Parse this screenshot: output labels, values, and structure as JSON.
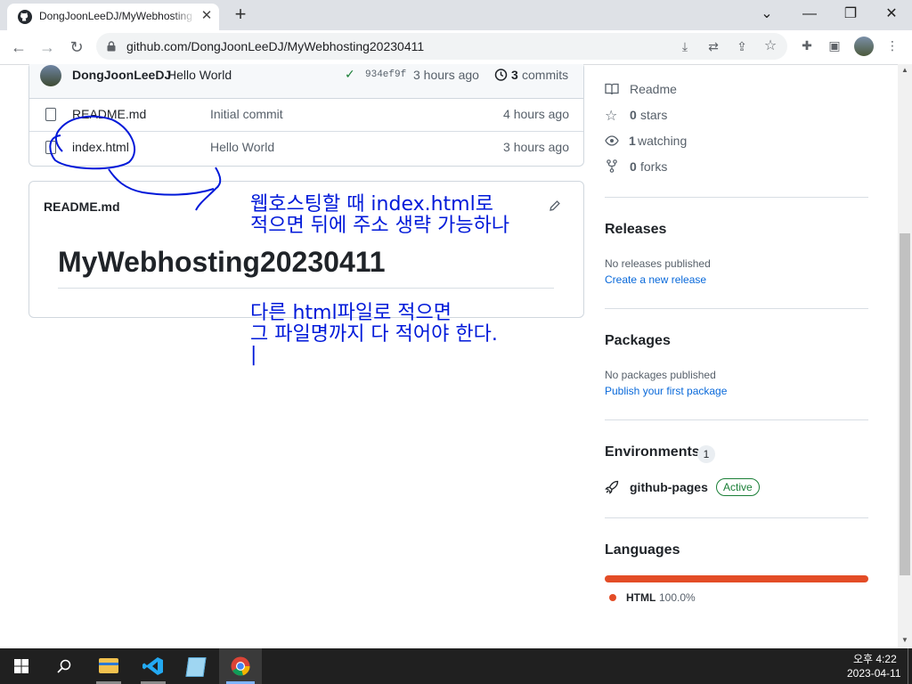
{
  "browser": {
    "tab_title": "DongJoonLeeDJ/MyWebhosting",
    "url": "github.com/DongJoonLeeDJ/MyWebhosting20230411"
  },
  "commit": {
    "author": "DongJoonLeeDJ",
    "message": "Hello World",
    "hash": "934ef9f",
    "time": "3 hours ago",
    "commits_count": "3",
    "commits_label": "commits"
  },
  "files": [
    {
      "name": "README.md",
      "message": "Initial commit",
      "time": "4 hours ago"
    },
    {
      "name": "index.html",
      "message": "Hello World",
      "time": "3 hours ago"
    }
  ],
  "readme": {
    "filename": "README.md",
    "heading": "MyWebhosting20230411"
  },
  "sidebar": {
    "readme_label": "Readme",
    "stars_count": "0",
    "stars_label": "stars",
    "watching_count": "1",
    "watching_label": "watching",
    "forks_count": "0",
    "forks_label": "forks",
    "releases_title": "Releases",
    "releases_none": "No releases published",
    "releases_link": "Create a new release",
    "packages_title": "Packages",
    "packages_none": "No packages published",
    "packages_link": "Publish your first package",
    "env_title": "Environments",
    "env_count": "1",
    "env_name": "github-pages",
    "env_status": "Active",
    "languages_title": "Languages",
    "lang_name": "HTML",
    "lang_percent": "100.0%",
    "lang_color": "#e34c26"
  },
  "annotations": {
    "line1": "웹호스팅할 때 index.html로",
    "line2": "적으면 뒤에 주소 생략 가능하나",
    "line3": "다른 html파일로 적으면",
    "line4": "그 파일명까지 다 적어야 한다.",
    "line5": "|"
  },
  "taskbar": {
    "time": "오후 4:22",
    "date": "2023-04-11"
  }
}
